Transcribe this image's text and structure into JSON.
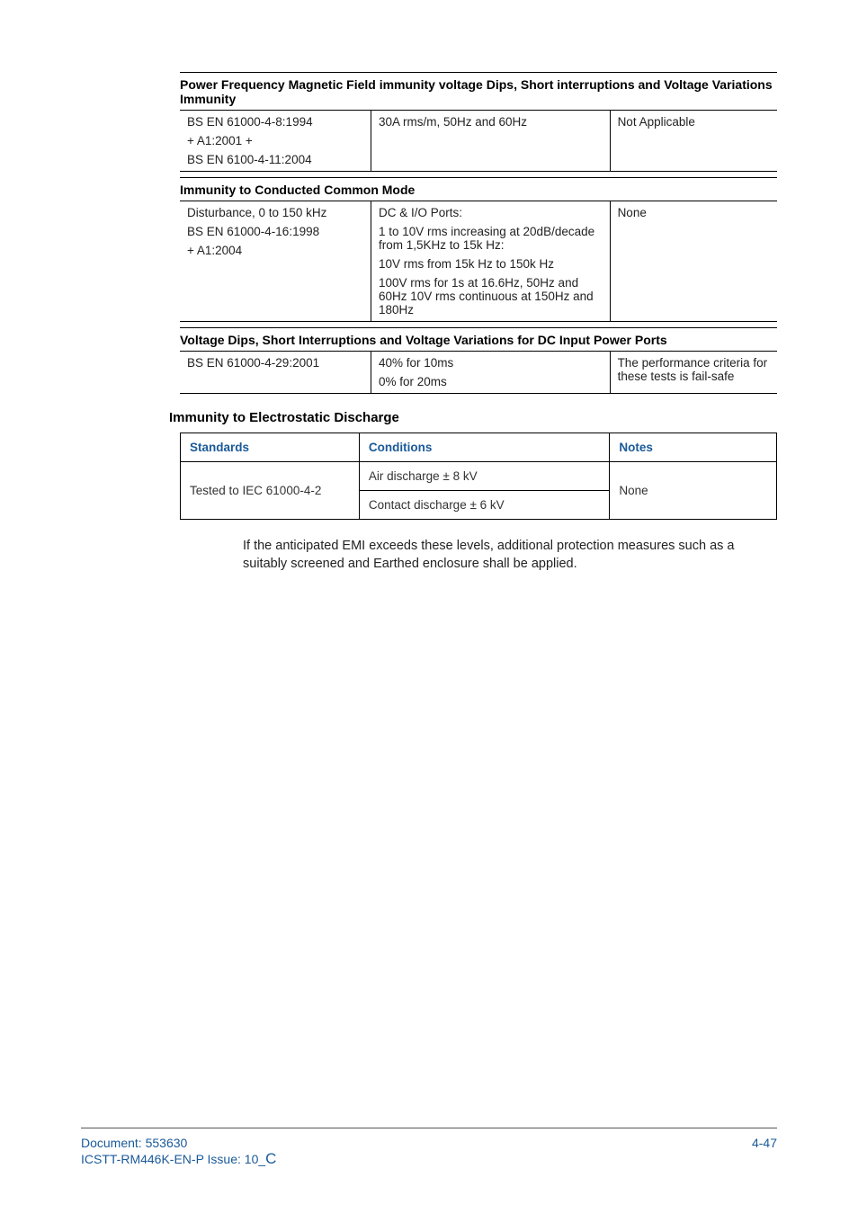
{
  "sections": {
    "powerFreq": {
      "title": "Power Frequency Magnetic Field immunity voltage Dips, Short interruptions and Voltage Variations Immunity",
      "c1a": "BS EN 61000-4-8:1994",
      "c1b": "+ A1:2001 +",
      "c1c": "BS EN 6100-4-11:2004",
      "c2": "30A rms/m, 50Hz and 60Hz",
      "c3": "Not Applicable"
    },
    "conducted": {
      "title": "Immunity to Conducted Common Mode",
      "c1a": "Disturbance, 0 to 150 kHz",
      "c1b": "BS EN 61000-4-16:1998",
      "c1c": "+ A1:2004",
      "c2a": "DC & I/O Ports:",
      "c2b": "1 to 10V rms increasing at 20dB/decade from 1,5KHz to 15k Hz:",
      "c2c": "10V rms from 15k Hz to 150k Hz",
      "c2d": "100V rms for 1s at 16.6Hz, 50Hz and 60Hz 10V rms continuous at 150Hz and 180Hz",
      "c3": "None"
    },
    "voltageDips": {
      "title": "Voltage Dips, Short Interruptions and Voltage Variations for DC Input Power Ports",
      "c1": "BS EN 61000-4-29:2001",
      "c2a": "40% for 10ms",
      "c2b": "0% for 20ms",
      "c3": "The performance criteria for these tests is fail-safe"
    }
  },
  "esd": {
    "heading": "Immunity to Electrostatic Discharge",
    "h1": "Standards",
    "h2": "Conditions",
    "h3": "Notes",
    "c1": "Tested to IEC 61000-4-2",
    "c2a": "Air discharge ± 8 kV",
    "c2b": "Contact discharge ± 6 kV",
    "c3": "None"
  },
  "para": "If the anticipated EMI exceeds these levels, additional protection measures such as a suitably screened and Earthed enclosure shall be applied.",
  "footer": {
    "l1": "Document: 553630",
    "l2a": "ICSTT-RM446K-EN-P Issue: 10_",
    "l2b": "C",
    "right": "4-47"
  }
}
